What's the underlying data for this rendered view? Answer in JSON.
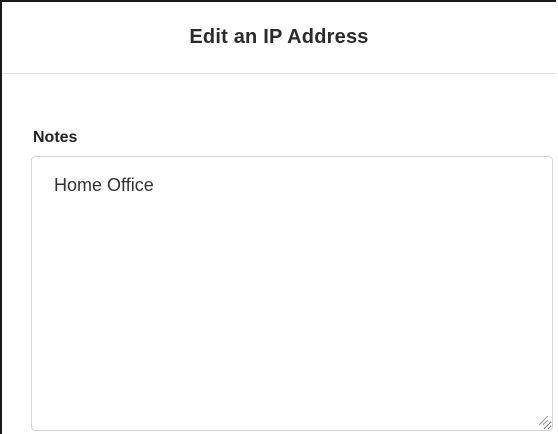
{
  "dialog": {
    "title": "Edit an IP Address"
  },
  "notes": {
    "label": "Notes",
    "value": "Home Office"
  }
}
